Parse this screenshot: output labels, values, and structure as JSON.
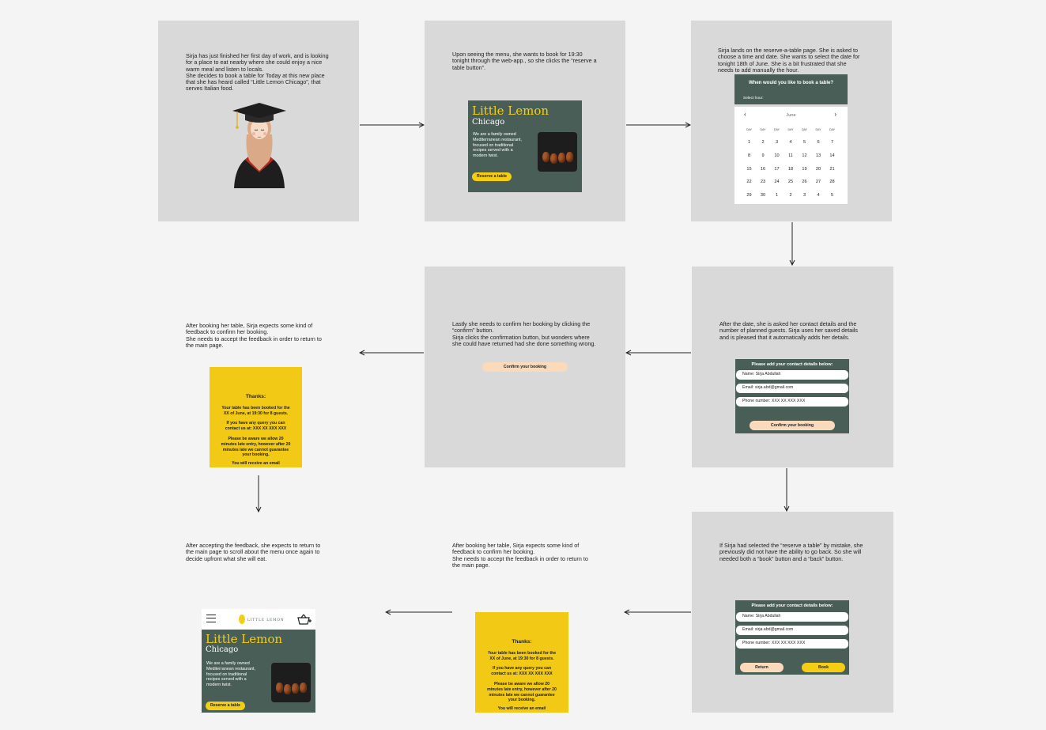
{
  "notes": {
    "p1": "Sirja has just finished her first day of work, and is looking\nfor a place to eat nearby where she could enjoy a nice\nwarm meal and listen to locals.\nShe decides to book a table for Today at this new place\nthat she has heard called “Little Lemon Chicago”, that\nserves Italian food.",
    "p2": "Upon seeing the menu, she wants to book for 19:30\ntonight through the web-app., so she clicks the “reserve a\ntable button”.",
    "p3": "Sirja lands on the reserve-a-table page. She is asked to\nchoose a time and date.  She wants to select the date for\ntonight 18th of June. She is a bit frustrated that she\nneeds to add manually the hour.",
    "p4": "Lastly she needs to confirm her booking by clicking the\n“confirm” button.\nSirja clicks the confirmation button, but wonders where\nshe could have returned had she done something wrong.",
    "p5": "After the date, she is asked her contact details and the\nnumber of planned guests. Sirja uses her saved details\nand is pleased that it automatically adds her details.",
    "p6": "After booking her table, Sirja expects some kind of\nfeedback to confirm her booking.\nShe needs to accept the feedback in order to return to\nthe main page.",
    "p7": "After accepting the feedback, she expects to return to\nthe main page to scroll about the menu once again to\ndecide upfront what she will eat.",
    "p8": "After booking her table, Sirja expects some kind of\nfeedback to confirm her booking.\nShe needs to accept the feedback in order to return to\nthe main page.",
    "p9": "If Sirja had selected the “reserve a table” by mistake, she\npreviously did not have the ability to go back. So she will\nneeded both a “book” button and a “back” button."
  },
  "hero": {
    "title": "Little Lemon",
    "city": "Chicago",
    "description": "We are a family owned\nMediterranean restaurant,\nfocused on traditional\nrecipes served with a\nmodern twist.",
    "button": "Reserve a table"
  },
  "calendar": {
    "question": "When would you like to book a table?",
    "hour_label": "Select hour:",
    "month": "June",
    "day_names": [
      "DAY",
      "DAY",
      "DAY",
      "DAY",
      "DAY",
      "DAY",
      "DAY"
    ],
    "weeks": [
      [
        "1",
        "2",
        "3",
        "4",
        "5",
        "6",
        "7"
      ],
      [
        "8",
        "9",
        "10",
        "11",
        "12",
        "13",
        "14"
      ],
      [
        "15",
        "16",
        "17",
        "18",
        "19",
        "20",
        "21"
      ],
      [
        "22",
        "23",
        "24",
        "25",
        "26",
        "27",
        "28"
      ],
      [
        "29",
        "30",
        "1",
        "2",
        "3",
        "4",
        "5"
      ]
    ]
  },
  "contact_form": {
    "title": "Please add your contact details below:",
    "name": "Name:  Sirja Abdullah",
    "email": "Email:  sirja.abd@gmail.com",
    "phone": "Phone number: XXX XX XXX XXX",
    "confirm": "Confirm your booking",
    "return": "Return",
    "book": "Book"
  },
  "confirm_button": "Confirm your booking",
  "thanks": {
    "title": "Thanks:",
    "line1": "Your table has been booked for the\nXX of June, at 19:30 for 8 guests.",
    "line2": "If you have any query you can\ncontact us at: XXX XX XXX XXX",
    "line3": "Please be aware we allow 20\nminutes late entry, however after 20\nminutes late we cannot guarantee\nyour booking.",
    "line4": "You will receive an email"
  },
  "brand": "LITTLE LEMON",
  "colors": {
    "green": "#495e57",
    "yellow": "#f4ce14",
    "peach": "#fbdabb",
    "panel": "#d9d9d9"
  }
}
